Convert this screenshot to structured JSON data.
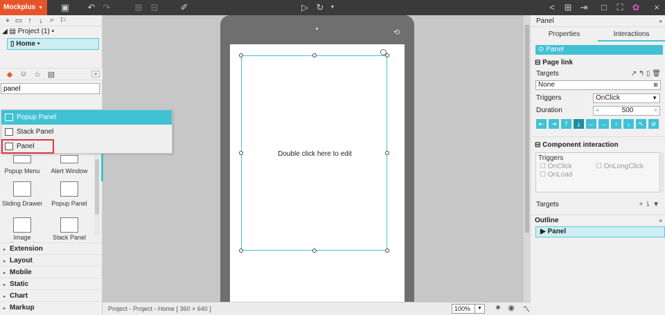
{
  "app": {
    "brand": "Mockplus",
    "accent": "#41c1d4",
    "brand_color": "#e8542a"
  },
  "toolbar": {
    "icons": [
      "save-icon",
      "undo-icon",
      "redo-icon",
      "align-icon",
      "distribute-icon",
      "format-brush-icon",
      "play-icon",
      "refresh-icon",
      "share-icon",
      "grid-icon",
      "export-icon",
      "window-icon",
      "fullscreen-icon",
      "gift-icon",
      "close-icon"
    ]
  },
  "project_tree": {
    "project": "Project (1)",
    "page": "Home"
  },
  "components": {
    "search_value": "panel",
    "dropdown": [
      "Popup Panel",
      "Stack Panel",
      "Panel"
    ],
    "grid": [
      "Popup Menu",
      "Alert Window",
      "Sliding Drawer",
      "Popup Panel",
      "Image Carousel",
      "Stack Panel"
    ],
    "categories": [
      "Extension",
      "Layout",
      "Mobile",
      "Static",
      "Chart",
      "Markup"
    ]
  },
  "canvas": {
    "panel_text": "Double click here to edit"
  },
  "statusbar": {
    "path": "Project - Project - Home [ 360 × 640 ]",
    "zoom": "100%"
  },
  "inspector": {
    "title": "Panel",
    "tabs": [
      "Properties",
      "Interactions"
    ],
    "active_tab": "Interactions",
    "selected": "Panel",
    "page_link": {
      "heading": "Page link",
      "targets_label": "Targets",
      "target_value": "None",
      "triggers_label": "Triggers",
      "trigger_value": "OnClick",
      "duration_label": "Duration",
      "duration_value": "500"
    },
    "component_interaction": {
      "heading": "Component interaction",
      "triggers_label": "Triggers",
      "onclick": "OnClick",
      "onlongclick": "OnLongClick",
      "onload": "OnLoad",
      "targets_label": "Targets"
    },
    "outline": {
      "heading": "Outline",
      "item": "Panel"
    }
  }
}
